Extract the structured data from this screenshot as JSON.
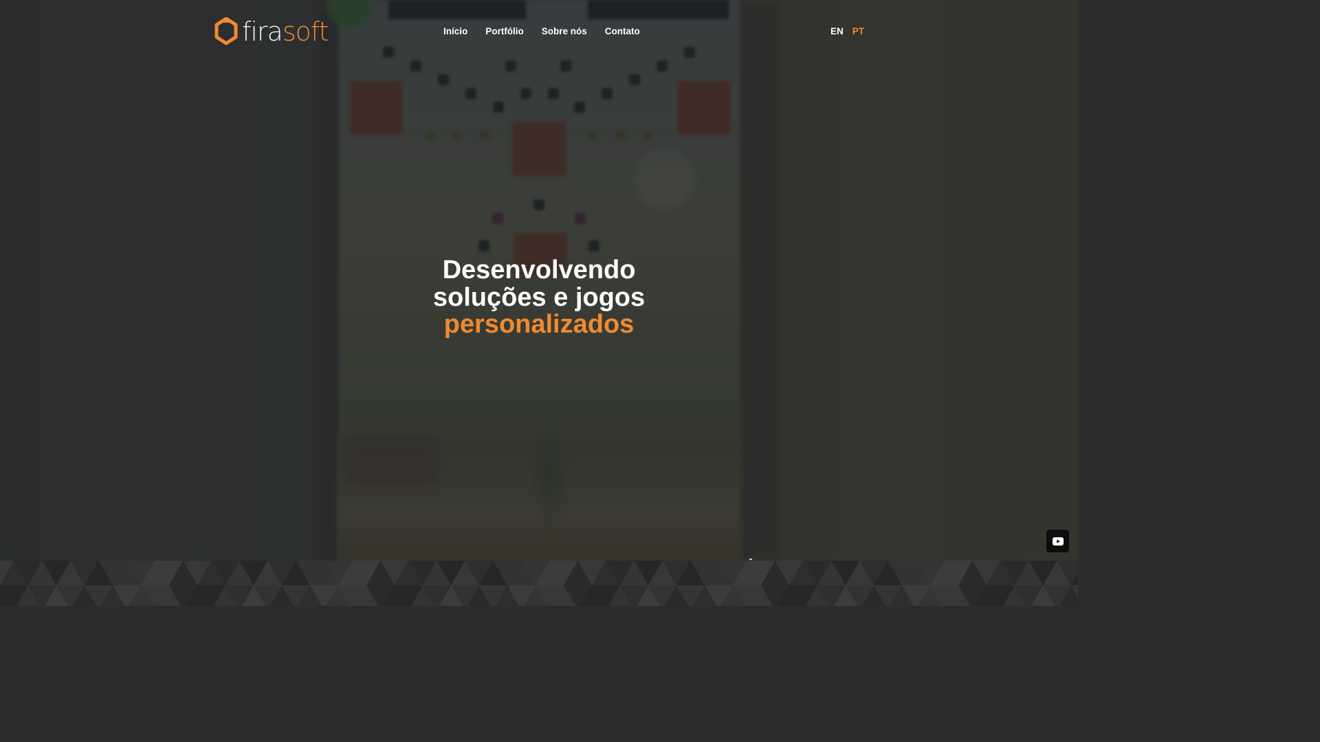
{
  "brand": {
    "name_part1": "fira",
    "name_part2": "soft",
    "icon": "hexagon-house-logo-icon",
    "accent_color": "#f08a30"
  },
  "nav": {
    "items": [
      {
        "label": "Início"
      },
      {
        "label": "Portfólio"
      },
      {
        "label": "Sobre nós"
      },
      {
        "label": "Contato"
      }
    ]
  },
  "language": {
    "options": [
      "EN",
      "PT"
    ],
    "selected": "PT"
  },
  "hero": {
    "line1": "Desenvolvendo",
    "line2": "soluções e jogos",
    "line3": "personalizados"
  },
  "floating": {
    "icon": "youtube-icon"
  }
}
